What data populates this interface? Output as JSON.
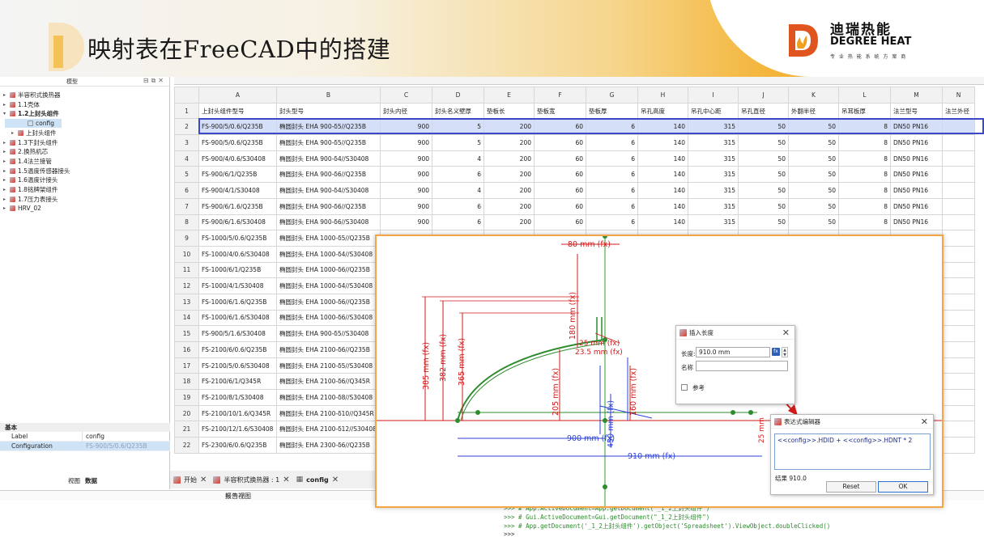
{
  "banner": {
    "title": "映射表在FreeCAD中的搭建",
    "logo_cn": "迪瑞热能",
    "logo_en": "DEGREE HEAT",
    "logo_sub": "专 业 热 能 系 统 方 案 商"
  },
  "tree": {
    "header": "模型",
    "items": [
      {
        "label": "半容积式换热器",
        "level": 0,
        "arrow": "▸"
      },
      {
        "label": "1.1壳体",
        "level": 0,
        "arrow": "▸"
      },
      {
        "label": "1.2上封头组件",
        "level": 0,
        "arrow": "▾",
        "bold": true
      },
      {
        "label": "config",
        "level": 2,
        "arrow": "",
        "selected": true
      },
      {
        "label": "上封头组件",
        "level": 1,
        "arrow": "▸"
      },
      {
        "label": "1.3下封头组件",
        "level": 0,
        "arrow": "▸"
      },
      {
        "label": "2.换热机芯",
        "level": 0,
        "arrow": "▸"
      },
      {
        "label": "1.4法兰接管",
        "level": 0,
        "arrow": "▸"
      },
      {
        "label": "1.5温度传感器接头",
        "level": 0,
        "arrow": "▸"
      },
      {
        "label": "1.6温度计接头",
        "level": 0,
        "arrow": "▸"
      },
      {
        "label": "1.8铭牌架组件",
        "level": 0,
        "arrow": "▸"
      },
      {
        "label": "1.7压力表接头",
        "level": 0,
        "arrow": "▸"
      },
      {
        "label": "HRV_02",
        "level": 0,
        "arrow": "▸"
      }
    ]
  },
  "properties": {
    "section": "基本",
    "rows": [
      {
        "key": "Label",
        "value": "config"
      },
      {
        "key": "Configuration",
        "value": "FS-900/5/0.6/Q235B"
      }
    ]
  },
  "left_tabs": [
    "视图",
    "数据"
  ],
  "sheet": {
    "columns": [
      "A",
      "B",
      "C",
      "D",
      "E",
      "F",
      "G",
      "H",
      "I",
      "J",
      "K",
      "L",
      "M",
      "N"
    ],
    "headers": [
      "上封头组件型号",
      "封头型号",
      "封头内径",
      "封头名义壁厚",
      "垫板长",
      "垫板宽",
      "垫板厚",
      "吊孔高度",
      "吊孔中心距",
      "吊孔直径",
      "外翻半径",
      "吊耳板厚",
      "法兰型号",
      "法兰外径"
    ],
    "rows": [
      [
        "FS-900/5/0.6/Q235B",
        "椭圆封头 EHA 900-δ5//Q235B",
        "900",
        "5",
        "200",
        "60",
        "6",
        "140",
        "315",
        "50",
        "50",
        "8",
        "DN50 PN16",
        ""
      ],
      [
        "FS-900/5/0.6/Q235B",
        "椭圆封头 EHA 900-δ5//Q235B",
        "900",
        "5",
        "200",
        "60",
        "6",
        "140",
        "315",
        "50",
        "50",
        "8",
        "DN50 PN16",
        ""
      ],
      [
        "FS-900/4/0.6/S30408",
        "椭圆封头 EHA 900-δ4//S30408",
        "900",
        "4",
        "200",
        "60",
        "6",
        "140",
        "315",
        "50",
        "50",
        "8",
        "DN50 PN16",
        ""
      ],
      [
        "FS-900/6/1/Q235B",
        "椭圆封头 EHA 900-δ6//Q235B",
        "900",
        "6",
        "200",
        "60",
        "6",
        "140",
        "315",
        "50",
        "50",
        "8",
        "DN50 PN16",
        ""
      ],
      [
        "FS-900/4/1/S30408",
        "椭圆封头 EHA 900-δ4//S30408",
        "900",
        "4",
        "200",
        "60",
        "6",
        "140",
        "315",
        "50",
        "50",
        "8",
        "DN50 PN16",
        ""
      ],
      [
        "FS-900/6/1.6/Q235B",
        "椭圆封头 EHA 900-δ6//Q235B",
        "900",
        "6",
        "200",
        "60",
        "6",
        "140",
        "315",
        "50",
        "50",
        "8",
        "DN50 PN16",
        ""
      ],
      [
        "FS-900/6/1.6/S30408",
        "椭圆封头 EHA 900-δ6//S30408",
        "900",
        "6",
        "200",
        "60",
        "6",
        "140",
        "315",
        "50",
        "50",
        "8",
        "DN50 PN16",
        ""
      ],
      [
        "FS-1000/5/0.6/Q235B",
        "椭圆封头 EHA 1000-δ5//Q235B",
        "",
        "",
        "",
        "",
        "",
        "",
        "",
        "",
        "",
        "",
        "",
        ""
      ],
      [
        "FS-1000/4/0.6/S30408",
        "椭圆封头 EHA 1000-δ4//S30408",
        "",
        "",
        "",
        "",
        "",
        "",
        "",
        "",
        "",
        "",
        "",
        ""
      ],
      [
        "FS-1000/6/1/Q235B",
        "椭圆封头 EHA 1000-δ6//Q235B",
        "",
        "",
        "",
        "",
        "",
        "",
        "",
        "",
        "",
        "",
        "",
        ""
      ],
      [
        "FS-1000/4/1/S30408",
        "椭圆封头 EHA 1000-δ4//S30408",
        "",
        "",
        "",
        "",
        "",
        "",
        "",
        "",
        "",
        "",
        "",
        ""
      ],
      [
        "FS-1000/6/1.6/Q235B",
        "椭圆封头 EHA 1000-δ6//Q235B",
        "",
        "",
        "",
        "",
        "",
        "",
        "",
        "",
        "",
        "",
        "",
        ""
      ],
      [
        "FS-1000/6/1.6/S30408",
        "椭圆封头 EHA 1000-δ6//S30408",
        "",
        "",
        "",
        "",
        "",
        "",
        "",
        "",
        "",
        "",
        "",
        ""
      ],
      [
        "FS-900/5/1.6/S30408",
        "椭圆封头 EHA 900-δ5//S30408",
        "",
        "",
        "",
        "",
        "",
        "",
        "",
        "",
        "",
        "",
        "",
        ""
      ],
      [
        "FS-2100/6/0.6/Q235B",
        "椭圆封头 EHA 2100-δ6//Q235B",
        "",
        "",
        "",
        "",
        "",
        "",
        "",
        "",
        "",
        "",
        "",
        ""
      ],
      [
        "FS-2100/5/0.6/S30408",
        "椭圆封头 EHA 2100-δ5//S30408",
        "",
        "",
        "",
        "",
        "",
        "",
        "",
        "",
        "",
        "",
        "",
        ""
      ],
      [
        "FS-2100/6/1/Q345R",
        "椭圆封头 EHA 2100-δ6//Q345R",
        "",
        "",
        "",
        "",
        "",
        "",
        "",
        "",
        "",
        "",
        "",
        ""
      ],
      [
        "FS-2100/8/1/S30408",
        "椭圆封头 EHA 2100-δ8//S30408",
        "",
        "",
        "",
        "",
        "",
        "",
        "",
        "",
        "",
        "",
        "",
        ""
      ],
      [
        "FS-2100/10/1.6/Q345R",
        "椭圆封头 EHA 2100-δ10//Q345R",
        "",
        "",
        "",
        "",
        "",
        "",
        "",
        "",
        "",
        "",
        "",
        ""
      ],
      [
        "FS-2100/12/1.6/S30408",
        "椭圆封头 EHA 2100-δ12//S30408",
        "",
        "",
        "",
        "",
        "",
        "",
        "",
        "",
        "",
        "",
        "",
        ""
      ],
      [
        "FS-2300/6/0.6/Q235B",
        "椭圆封头 EHA 2300-δ6//Q235B",
        "",
        "",
        "",
        "",
        "",
        "",
        "",
        "",
        "",
        "",
        "",
        ""
      ]
    ]
  },
  "doc_tabs": [
    {
      "label": "开始",
      "close": "✕"
    },
    {
      "label": "半容积式换热器 : 1",
      "close": "✕"
    },
    {
      "label": "config",
      "close": "✕",
      "active": true
    }
  ],
  "report": {
    "title": "报告视图"
  },
  "console": [
    ">>> # App.ActiveDocument=App.getDocument(\"_1_2上封头组件\")",
    ">>> # Gui.ActiveDocument=Gui.getDocument(\"_1_2上封头组件\")",
    ">>> # App.getDocument('_1_2上封头组件').getObject('Spreadsheet').ViewObject.doubleClicked()",
    ">>>"
  ],
  "sketch": {
    "dims": {
      "d80": "80 mm (fx)",
      "d385": "385 mm (fx)",
      "d382": "382 mm (fx)",
      "d365": "365 mm (fx)",
      "d180": "180 mm (fx)",
      "d25": "25 mm (fx)",
      "d23": "23.5 mm (fx)",
      "d205": "205 mm (fx)",
      "d160": "160 mm (fx)",
      "d450": "450 mm (fx)",
      "d900": "900 mm (fx)",
      "d910": "910 mm (fx)",
      "d25b": "25 mm"
    }
  },
  "len_dialog": {
    "title": "插入长度",
    "length_label": "长度:",
    "length_value": "910.0 mm",
    "name_label": "名称",
    "ref_label": "参考",
    "fx": "fx"
  },
  "expr_dialog": {
    "title": "表达式编辑器",
    "expression": "<<config>>.HDID + <<config>>.HDNT * 2",
    "result": "结果 910.0",
    "reset": "Reset",
    "ok": "OK"
  },
  "colors": {
    "accent": "#f1a829",
    "selection": "#3b48c8",
    "dim_red": "#d31a1a",
    "dim_blue": "#2b3fd6",
    "green": "#2e8b2e"
  }
}
